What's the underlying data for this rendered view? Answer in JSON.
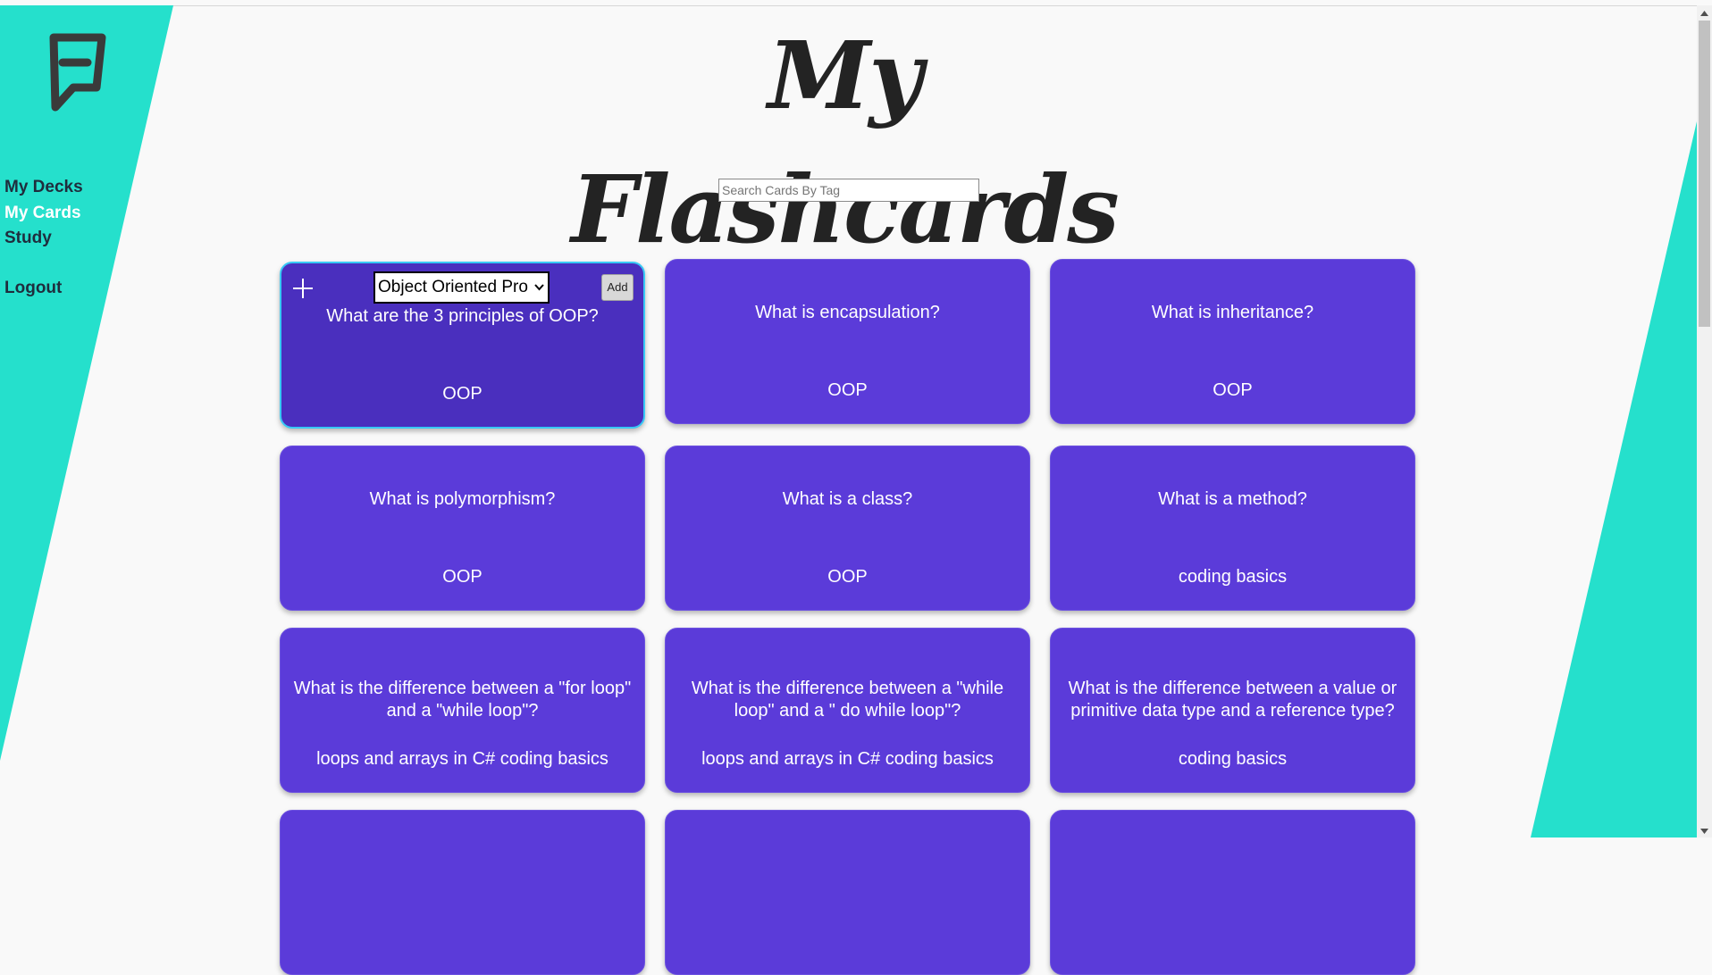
{
  "colors": {
    "sidebar_teal": "#25e0cc",
    "card_purple": "#5b3bd9",
    "card_selected": "#4a2fbe",
    "selected_border": "#38c9f5",
    "nav_text": "#1f2d3d",
    "nav_active": "#ffffff"
  },
  "logo": {
    "icon": "flag-f-logo"
  },
  "nav": {
    "items": [
      {
        "label": "My Decks",
        "active": false
      },
      {
        "label": "My Cards",
        "active": true
      },
      {
        "label": "Study",
        "active": false
      }
    ],
    "logout": "Logout"
  },
  "header": {
    "title": "My Flashcards"
  },
  "search": {
    "placeholder": "Search Cards By Tag",
    "value": ""
  },
  "selected_card": {
    "deck_select_value": "Object Oriented Pro",
    "add_label": "Add",
    "plus_icon": "plus-icon"
  },
  "cards": [
    {
      "question": "What are the 3 principles of OOP?",
      "tag": "OOP"
    },
    {
      "question": "What is encapsulation?",
      "tag": "OOP"
    },
    {
      "question": "What is inheritance?",
      "tag": "OOP"
    },
    {
      "question": "What is polymorphism?",
      "tag": "OOP"
    },
    {
      "question": "What is a class?",
      "tag": "OOP"
    },
    {
      "question": "What is a method?",
      "tag": "coding basics"
    },
    {
      "question": "What is the difference between a \"for loop\" and a \"while loop\"?",
      "tag": "loops and arrays in C# coding basics"
    },
    {
      "question": "What is the difference between a \"while loop\" and a \" do while loop\"?",
      "tag": "loops and arrays in C# coding basics"
    },
    {
      "question": "What is the difference between a value or primitive data type and a reference type?",
      "tag": "coding basics"
    },
    {
      "question": "",
      "tag": ""
    },
    {
      "question": "",
      "tag": ""
    },
    {
      "question": "",
      "tag": ""
    }
  ]
}
